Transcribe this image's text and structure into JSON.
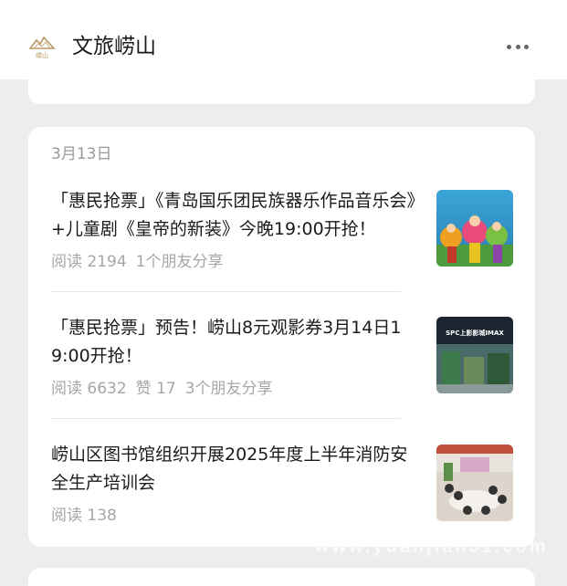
{
  "header": {
    "account_name": "文旅崂山",
    "logo_text": "崂山",
    "more_icon": "more-dots-icon"
  },
  "feed": {
    "date": "3月13日",
    "articles": [
      {
        "title": "「惠民抢票」《青岛国乐团民族器乐作品音乐会》+儿童剧《皇帝的新装》今晚19:00开抢！",
        "meta": [
          "阅读 2194",
          "1个朋友分享"
        ]
      },
      {
        "title": "「惠民抢票」预告！崂山8元观影券3月14日19:00开抢！",
        "meta": [
          "阅读 6632",
          "赞 17",
          "3个朋友分享"
        ],
        "thumb_text": "SPC上影影城IMAX"
      },
      {
        "title": "崂山区图书馆组织开展2025年度上半年消防安全生产培训会",
        "meta": [
          "阅读 138"
        ]
      }
    ]
  },
  "watermark": "www.yuanjian51.com"
}
